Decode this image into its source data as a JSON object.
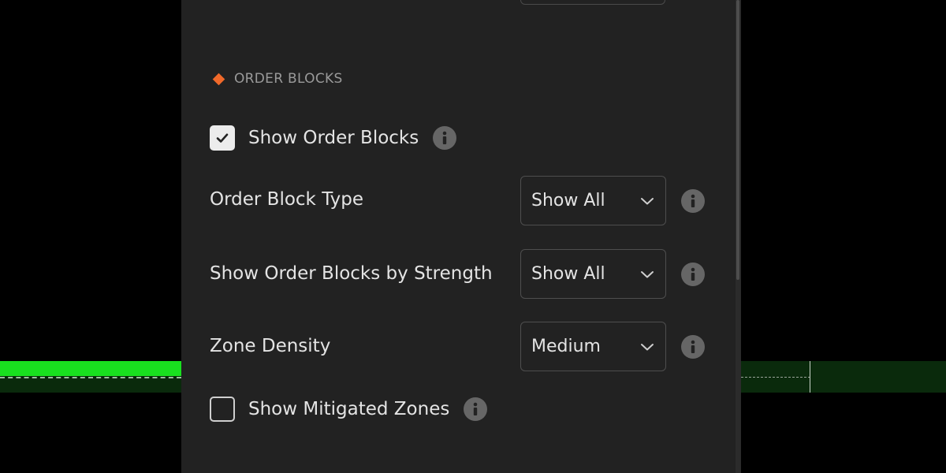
{
  "colors": {
    "page_background": "#000000",
    "panel_background": "#222222",
    "accent_orange": "#f0692a",
    "zone_green_bright": "#19e01f",
    "zone_green_dark": "#0a2a0c",
    "text_primary": "#e4e4e4",
    "text_section": "#9a9a9a",
    "info_icon": "#666666"
  },
  "section": {
    "icon": "diamond-icon",
    "title": "ORDER BLOCKS"
  },
  "show_order_blocks": {
    "label": "Show Order Blocks",
    "checked": true,
    "icon": "info-icon"
  },
  "order_block_type": {
    "label": "Order Block Type",
    "value": "Show All",
    "icon": "chevron-down-icon"
  },
  "order_blocks_by_strength": {
    "label": "Show Order Blocks by Strength",
    "value": "Show All",
    "icon": "chevron-down-icon"
  },
  "zone_density": {
    "label": "Zone Density",
    "value": "Medium",
    "icon": "chevron-down-icon"
  },
  "show_mitigated_zones": {
    "label": "Show Mitigated Zones",
    "checked": false,
    "icon": "info-icon"
  }
}
